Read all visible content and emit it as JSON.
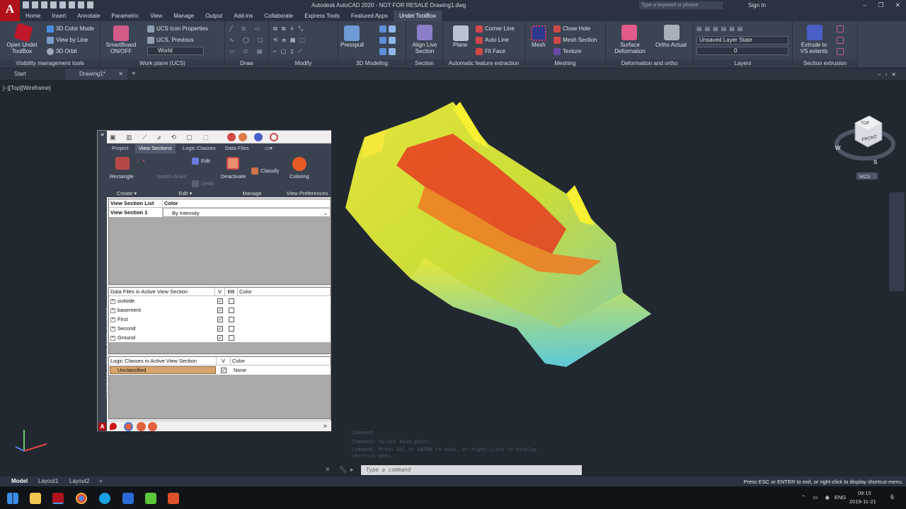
{
  "app": {
    "logo": "A",
    "title": "Autodesk AutoCAD 2020 - NOT FOR RESALE    Drawing1.dwg",
    "search_placeholder": "Type a keyword or phrase",
    "sign_in": "Sign In"
  },
  "ribbon_tabs": [
    "Home",
    "Insert",
    "Annotate",
    "Parametric",
    "View",
    "Manage",
    "Output",
    "Add-ins",
    "Collaborate",
    "Express Tools",
    "Featured Apps",
    "Undet ToolBox"
  ],
  "ribbon": {
    "open_undet": "Open Undet",
    "toolbox": "ToolBox",
    "color_mode": "3D Color Mode",
    "view_by_line": "View by Line",
    "orbit": "3D Orbit",
    "visibility_panel": "Visibility management tools",
    "smartboard": "SmartBoard",
    "on_off": "ON/OFF",
    "ucs_icon_props": "UCS Icon Properties",
    "ucs_previous": "UCS, Previous",
    "world": "World",
    "work_plane_panel": "Work plane (UCS)",
    "draw_panel": "Draw",
    "modify_panel": "Modify",
    "presspull": "Presspull",
    "modeling_panel": "3D Modeling",
    "align_live": "Align Live",
    "section": "Section",
    "section_panel": "Section",
    "plane": "Plane",
    "corner_line": "Corner Line",
    "auto_line": "Auto Line",
    "fit_face": "Fit Face",
    "feature_panel": "Automatic feature extraction",
    "mesh": "Mesh",
    "close_hole": "Close Hole",
    "mesh_section": "Mesh Section",
    "texture": "Texture",
    "meshing_panel": "Meshing",
    "surface": "Surface",
    "deformation": "Deformation",
    "ortho_actual": "Ortho Actual",
    "deform_panel": "Deformation and ortho",
    "layer_state": "Unsaved Layer State",
    "layer_current": "0",
    "layers_panel": "Layers",
    "extrude_to": "Extrude to",
    "vs_extents": "VS extents",
    "extrusion_panel": "Section extrusion"
  },
  "doc_tabs": [
    "Start",
    "Drawing1*"
  ],
  "viewport_label": "[–][Top][Wireframe]",
  "viewcube": {
    "top": "TOP",
    "front": "FRONT",
    "w": "W",
    "s": "S",
    "wcs": "WCS"
  },
  "palette": {
    "side_title": "UNDET FOR AUTOCAD (18078_CANFORD)",
    "tabs": [
      "Project",
      "View Sections",
      "Logic Classes",
      "Data Files"
    ],
    "active_tab": "View Sections",
    "buttons": {
      "rectangle": "Rectangle",
      "switch_grips": "Switch Grips",
      "edit": "Edit",
      "undo": "Undo",
      "deactivate": "Deactivate",
      "classify": "Classify",
      "coloring": "Coloring"
    },
    "groups": {
      "create": "Create",
      "edit": "Edit",
      "manage": "Manage",
      "view_prefs": "View Preferences"
    },
    "view_section_list": {
      "headers": [
        "View Section List",
        "Color"
      ],
      "rows": [
        {
          "name": "View Section 1",
          "color": "By Intensity"
        }
      ]
    },
    "data_files": {
      "headers": [
        "Data Files in Active View Section",
        "V",
        "BB",
        "Color"
      ],
      "rows": [
        {
          "name": "outside",
          "v": true,
          "bb": false
        },
        {
          "name": "basement",
          "v": true,
          "bb": false
        },
        {
          "name": "First",
          "v": true,
          "bb": false
        },
        {
          "name": "Second",
          "v": true,
          "bb": false
        },
        {
          "name": "Ground",
          "v": true,
          "bb": false
        }
      ]
    },
    "logic_classes": {
      "headers": [
        "Logic Classes in Active View Section",
        "V",
        "Color"
      ],
      "rows": [
        {
          "name": "Unclassified",
          "v": true,
          "color": "None"
        }
      ]
    }
  },
  "command": {
    "history": [
      "Command:",
      "Command:  Select base point:",
      "Command: Press ESC or ENTER to exit, or right-click to display",
      "shortcut-menu."
    ],
    "placeholder": "Type a command"
  },
  "layout_tabs": [
    "Model",
    "Layout1",
    "Layout2"
  ],
  "status_message": "Press ESC or ENTER to exit, or right-click to display shortcut-menu.",
  "taskbar": {
    "lang": "ENG",
    "time": "09:15",
    "date": "2019-11-21",
    "notif": "6"
  }
}
